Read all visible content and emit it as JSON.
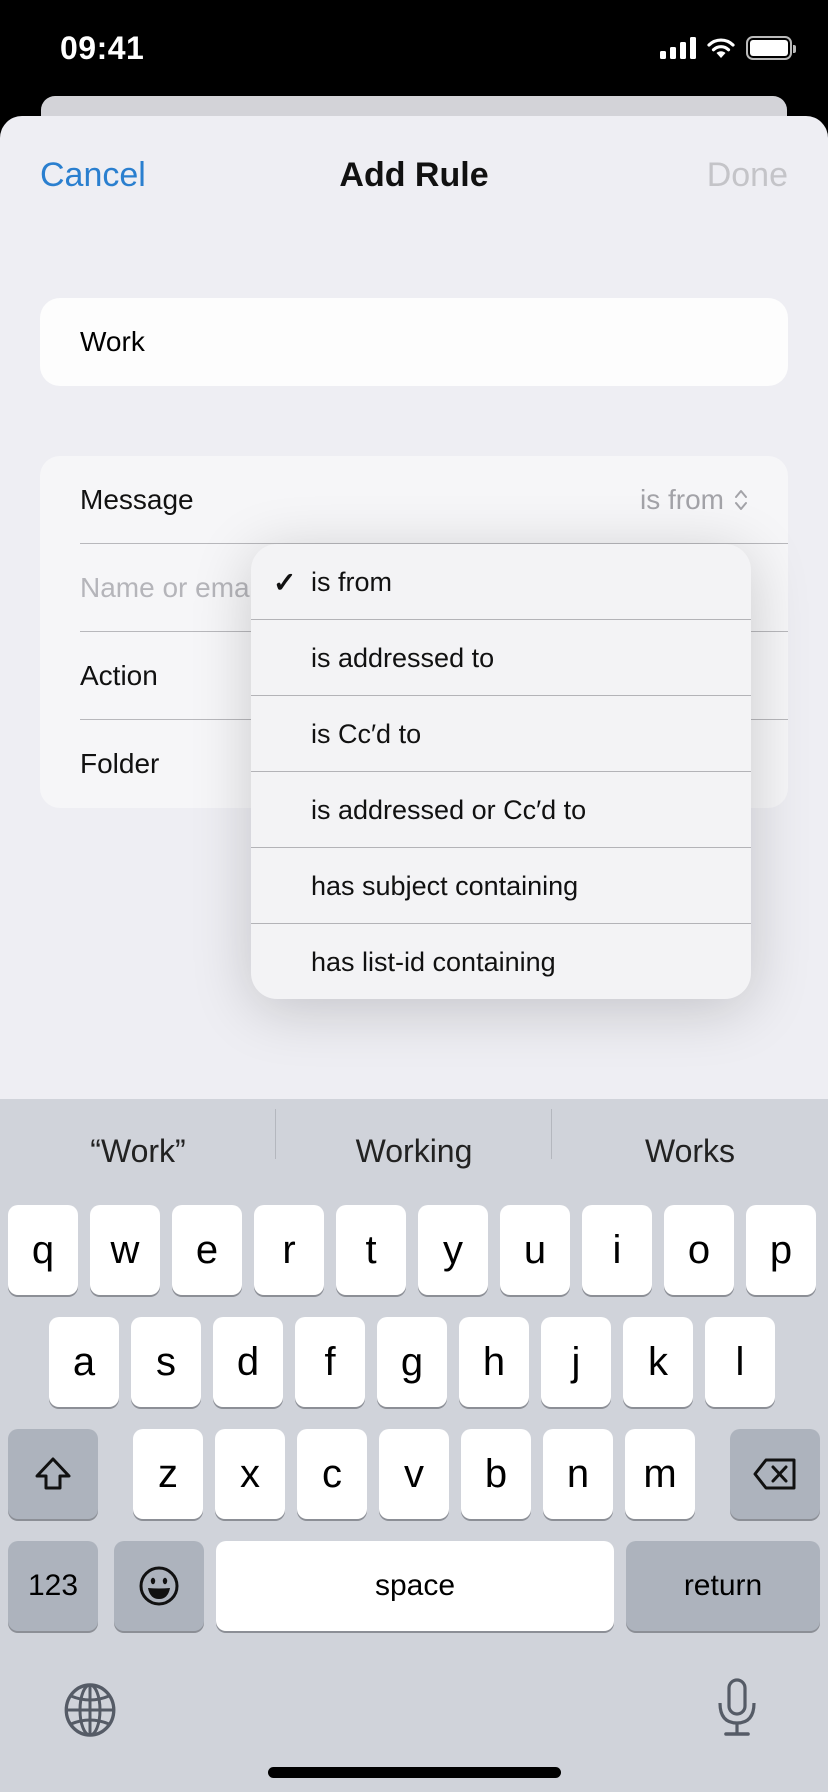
{
  "status_bar": {
    "time": "09:41",
    "icons": [
      "cellular-signal-icon",
      "wifi-icon",
      "battery-icon"
    ]
  },
  "nav": {
    "cancel_label": "Cancel",
    "title": "Add Rule",
    "done_label": "Done",
    "accent": "#2a7fcf",
    "done_disabled": true
  },
  "rule_name": {
    "value": "Work"
  },
  "rule_form": {
    "message_label": "Message",
    "message_condition": "is from",
    "sender_placeholder": "Name or email",
    "sender_placeholder_visible": "Name or ema",
    "action_label": "Action",
    "folder_label": "Folder"
  },
  "condition_menu": {
    "selected_index": 0,
    "items": [
      {
        "label": "is from",
        "checked": true
      },
      {
        "label": "is addressed to",
        "checked": false
      },
      {
        "label": "is Cc′d to",
        "checked": false
      },
      {
        "label": "is addressed or Cc′d to",
        "checked": false
      },
      {
        "label": "has subject containing",
        "checked": false
      },
      {
        "label": "has list-id containing",
        "checked": false
      }
    ]
  },
  "keyboard": {
    "suggestions": [
      "“Work”",
      "Working",
      "Works"
    ],
    "row1": [
      "q",
      "w",
      "e",
      "r",
      "t",
      "y",
      "u",
      "i",
      "o",
      "p"
    ],
    "row2": [
      "a",
      "s",
      "d",
      "f",
      "g",
      "h",
      "j",
      "k",
      "l"
    ],
    "row3": [
      "z",
      "x",
      "c",
      "v",
      "b",
      "n",
      "m"
    ],
    "shift_icon": "shift-icon",
    "delete_icon": "delete-icon",
    "numbers_label": "123",
    "emoji_icon": "emoji-icon",
    "space_label": "space",
    "return_label": "return",
    "globe_icon": "globe-icon",
    "mic_icon": "microphone-icon"
  }
}
